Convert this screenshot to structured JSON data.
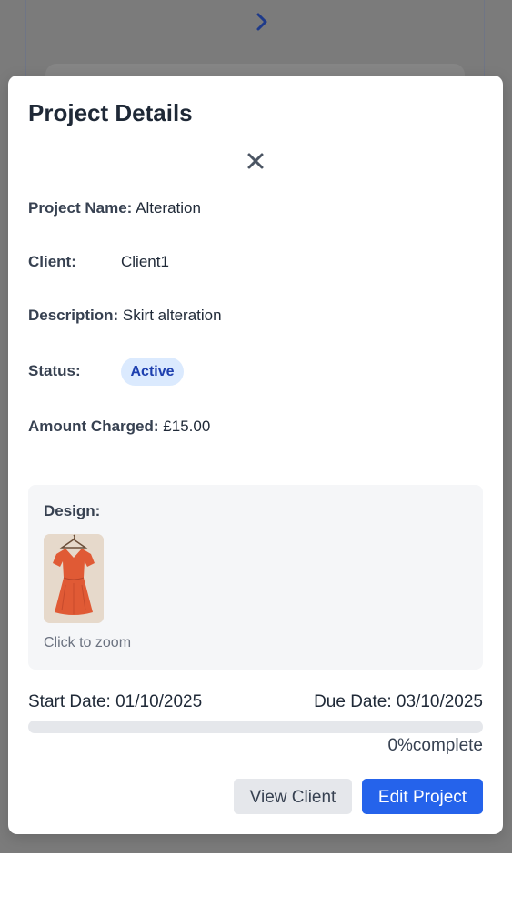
{
  "modal": {
    "title": "Project Details",
    "fields": {
      "project_name_label": "Project Name:",
      "project_name_value": "Alteration",
      "client_label": "Client:",
      "client_value": "Client1",
      "description_label": "Description:",
      "description_value": "Skirt alteration",
      "status_label": "Status:",
      "status_value": "Active",
      "amount_label": "Amount Charged:",
      "amount_value": "£15.00"
    },
    "design": {
      "label": "Design:",
      "zoom_hint": "Click to zoom"
    },
    "dates": {
      "start": "Start Date: 01/10/2025",
      "due": "Due Date: 03/10/2025"
    },
    "progress": {
      "percent": 0,
      "text": "0%complete"
    },
    "buttons": {
      "view_client": "View Client",
      "edit_project": "Edit Project"
    }
  },
  "colors": {
    "primary": "#2563eb",
    "badge_bg": "#dbeafe",
    "badge_text": "#1e40af",
    "overlay": "#7b7b7b"
  }
}
